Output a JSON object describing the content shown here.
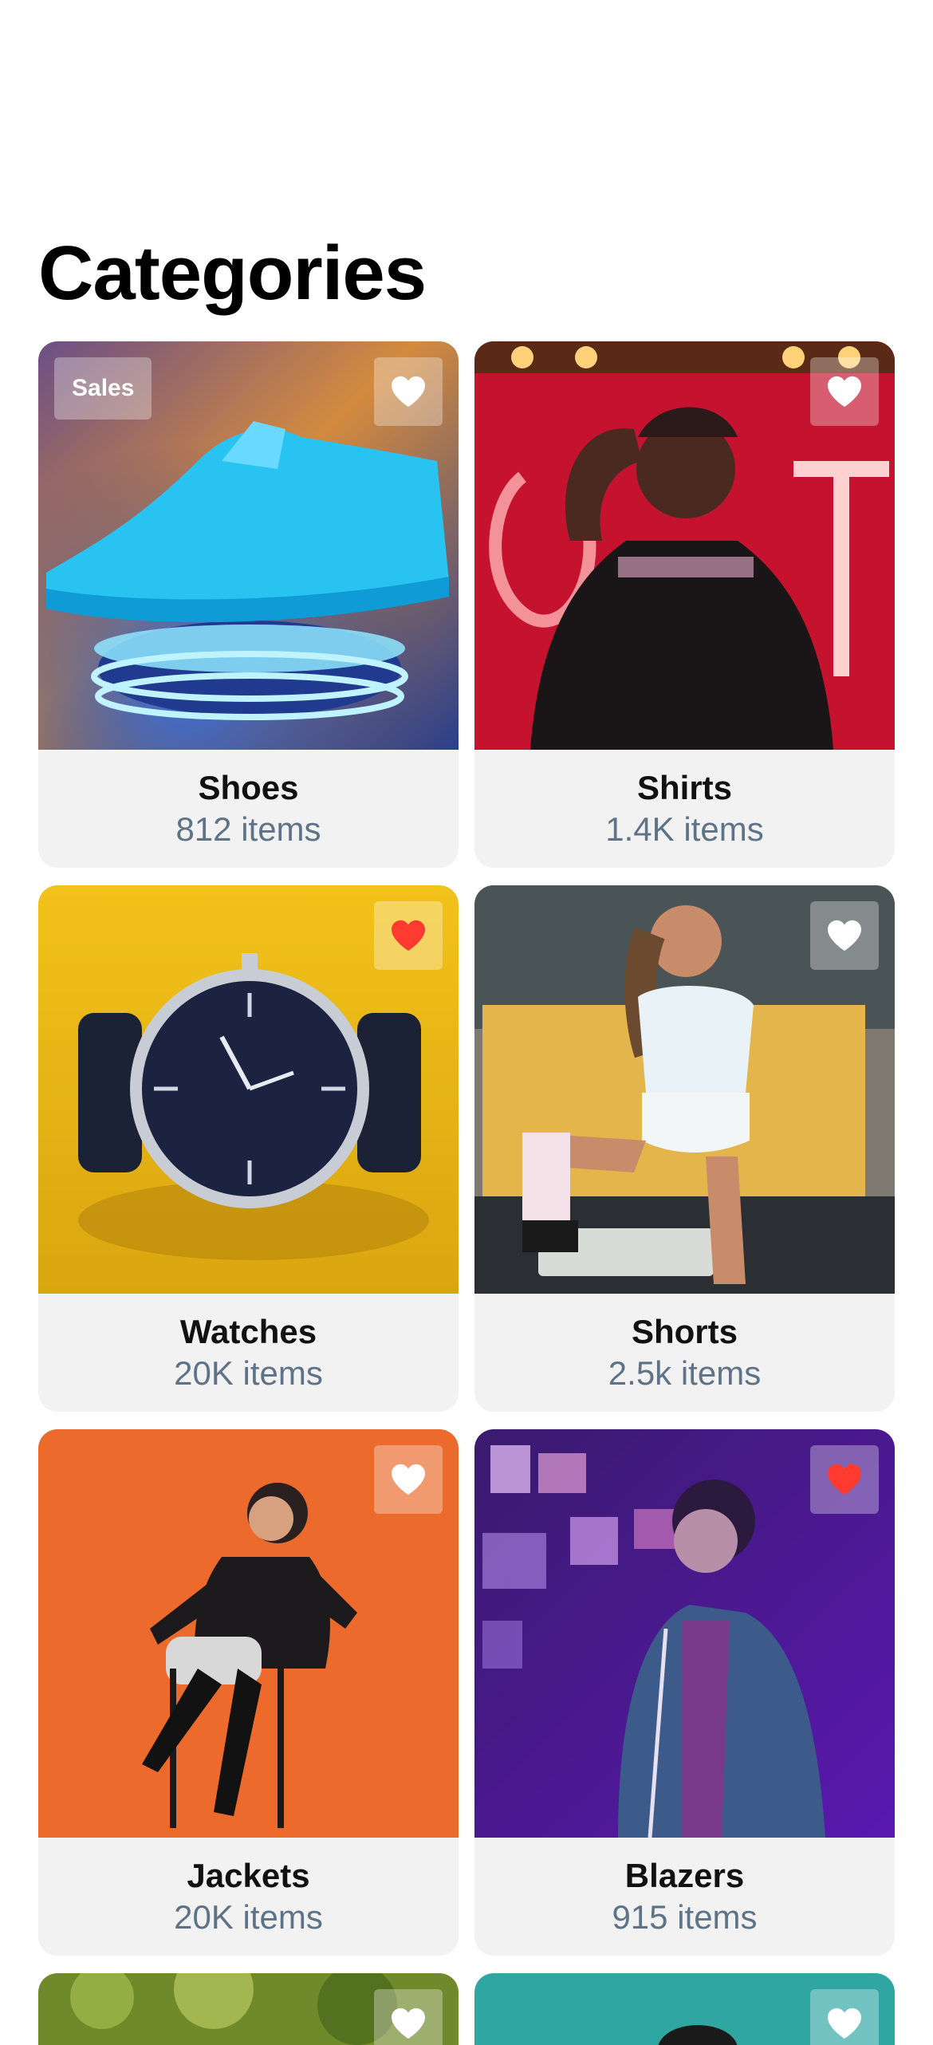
{
  "page": {
    "title": "Categories"
  },
  "colors": {
    "heart_active": "#ff3b30",
    "heart_inactive": "#ffffff",
    "caption_bg": "#f2f2f2",
    "count_text": "#5e7387"
  },
  "categories": [
    {
      "name": "Shoes",
      "count": "812 items",
      "favorite": false,
      "badge": "Sales"
    },
    {
      "name": "Shirts",
      "count": "1.4K items",
      "favorite": false
    },
    {
      "name": "Watches",
      "count": "20K items",
      "favorite": true
    },
    {
      "name": "Shorts",
      "count": "2.5k items",
      "favorite": false
    },
    {
      "name": "Jackets",
      "count": "20K items",
      "favorite": false
    },
    {
      "name": "Blazers",
      "count": "915 items",
      "favorite": true
    },
    {
      "name": "",
      "count": "",
      "favorite": false
    },
    {
      "name": "",
      "count": "",
      "favorite": false
    }
  ],
  "icons": {
    "favorite": "heart-icon"
  }
}
